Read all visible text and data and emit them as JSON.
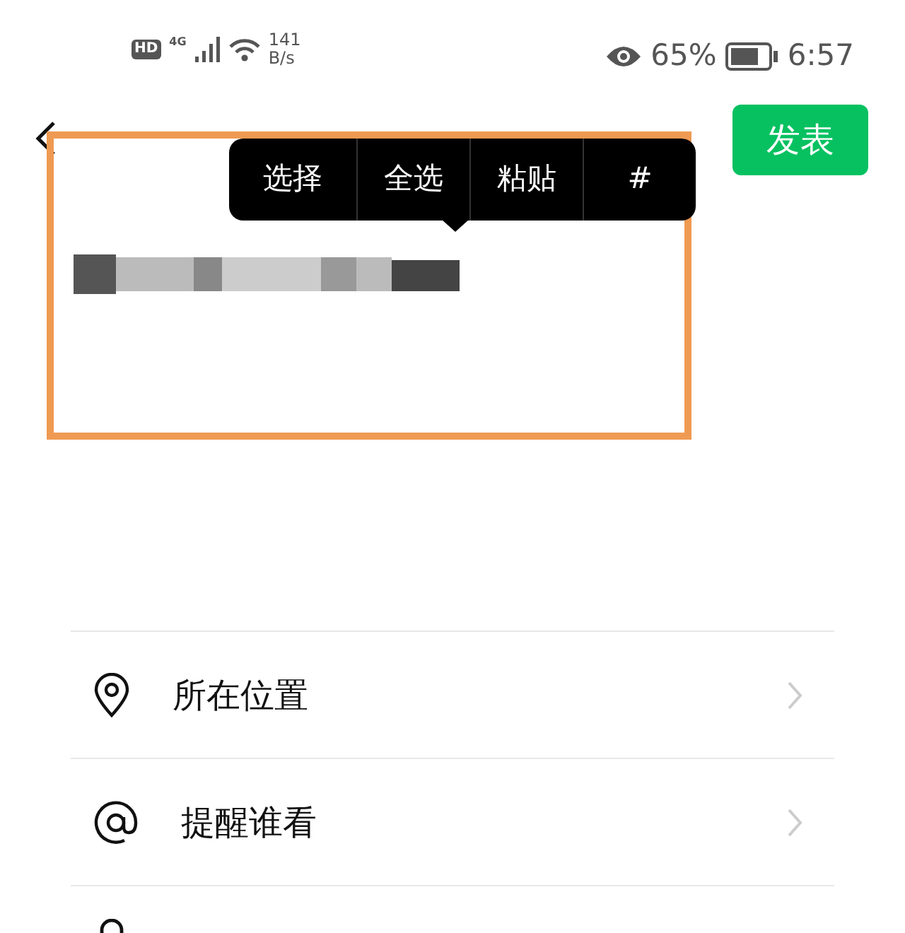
{
  "status_bar": {
    "hd_label": "HD",
    "network_label": "4G",
    "speed_value": "141",
    "speed_unit": "B/s",
    "battery_percent": "65%",
    "time": "6:57"
  },
  "header": {
    "publish_button": "发表"
  },
  "popup_menu": {
    "items": [
      "选择",
      "全选",
      "粘贴",
      "#"
    ]
  },
  "options": [
    {
      "kind": "location",
      "label": "所在位置"
    },
    {
      "kind": "mention",
      "label": "提醒谁看"
    },
    {
      "kind": "lock"
    }
  ]
}
